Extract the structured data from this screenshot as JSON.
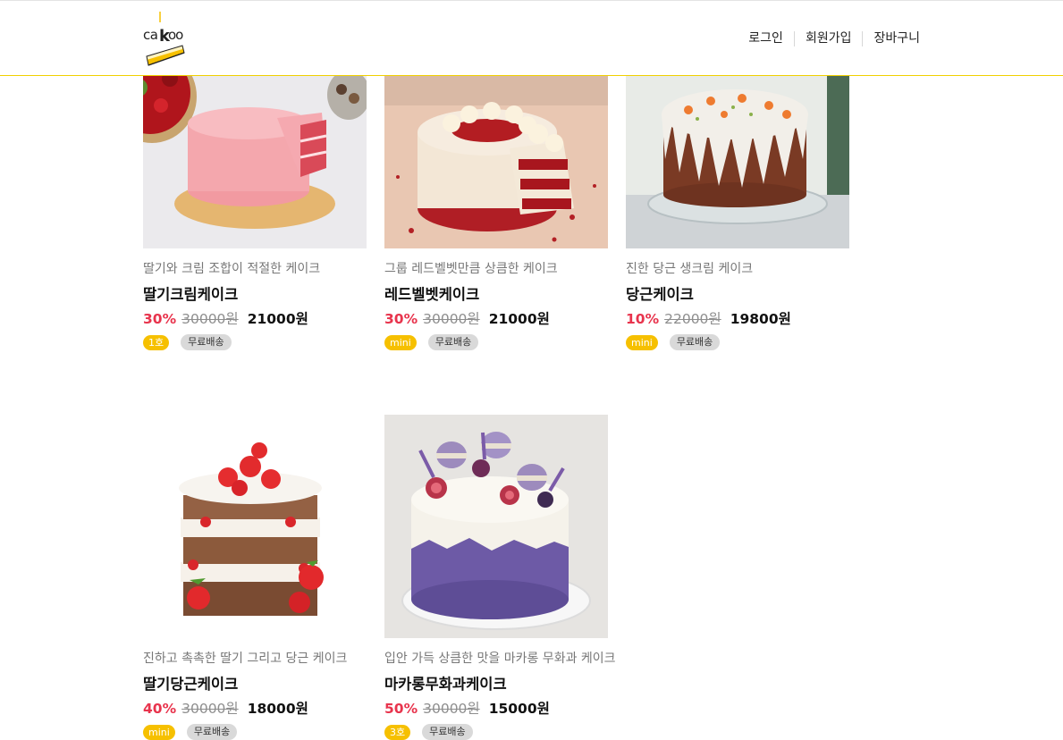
{
  "header": {
    "logo_text": "cakoo",
    "nav": [
      "로그인",
      "회원가입",
      "장바구니"
    ]
  },
  "products": [
    {
      "desc": "딸기와 크림 조합이 적절한 케이크",
      "name": "딸기크림케이크",
      "rate": "30%",
      "original": "30000원",
      "price": "21000원",
      "size_tag": "1호",
      "ship_tag": "무료배송"
    },
    {
      "desc": "그룹 레드벨벳만큼 상큼한 케이크",
      "name": "레드벨벳케이크",
      "rate": "30%",
      "original": "30000원",
      "price": "21000원",
      "size_tag": "mini",
      "ship_tag": "무료배송"
    },
    {
      "desc": "진한 당근 생크림 케이크",
      "name": "당근케이크",
      "rate": "10%",
      "original": "22000원",
      "price": "19800원",
      "size_tag": "mini",
      "ship_tag": "무료배송"
    },
    {
      "desc": "진하고 촉촉한 딸기 그리고 당근 케이크",
      "name": "딸기당근케이크",
      "rate": "40%",
      "original": "30000원",
      "price": "18000원",
      "size_tag": "mini",
      "ship_tag": "무료배송"
    },
    {
      "desc": "입안 가득 상큼한 맛을 마카롱 무화과 케이크",
      "name": "마카롱무화과케이크",
      "rate": "50%",
      "original": "30000원",
      "price": "15000원",
      "size_tag": "3호",
      "ship_tag": "무료배송"
    }
  ],
  "colors": {
    "accent": "#f6c000",
    "discount": "#e8344d",
    "header_border": "#f0d000"
  }
}
